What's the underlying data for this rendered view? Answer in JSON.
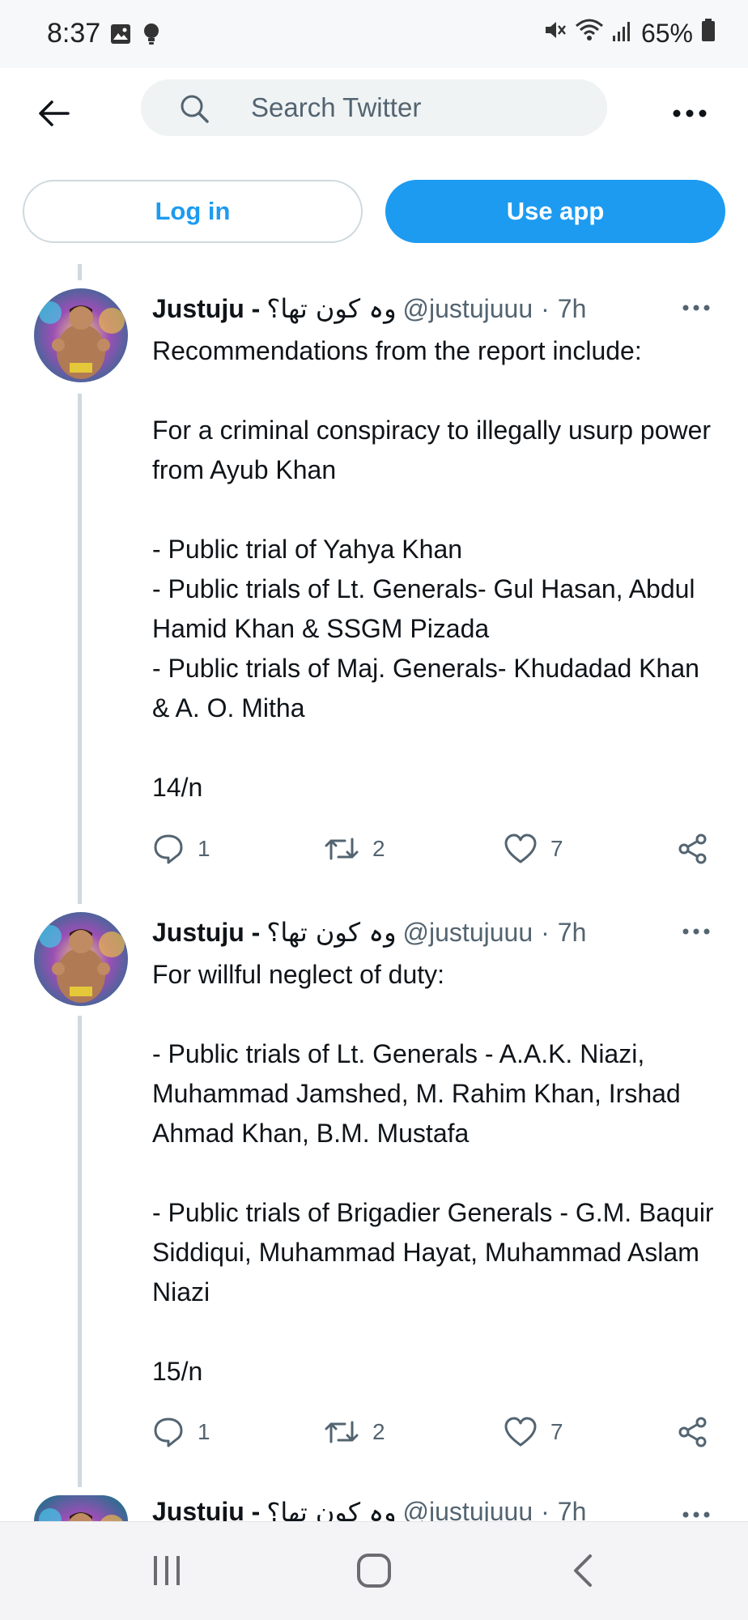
{
  "status_bar": {
    "time": "8:37",
    "battery": "65%",
    "left_icons": [
      "image-icon",
      "bulb-icon"
    ],
    "right_icons": [
      "mute-icon",
      "wifi-icon",
      "signal-icon",
      "battery-icon"
    ]
  },
  "nav": {
    "search_placeholder": "Search Twitter"
  },
  "auth": {
    "login_label": "Log in",
    "useapp_label": "Use app"
  },
  "colors": {
    "accent": "#1d9bf0",
    "text_secondary": "#536471",
    "thread_line": "#cfd9de"
  },
  "tweets": [
    {
      "name": "Justuju -",
      "urdu_name": "وہ کون تھا؟",
      "handle": "@justujuuu",
      "time": "7h",
      "text": "Recommendations from the report include:\n\nFor a criminal conspiracy to illegally usurp power from Ayub Khan\n\n- Public trial of Yahya Khan\n- Public trials of Lt. Generals- Gul Hasan, Abdul Hamid Khan & SSGM Pizada\n- Public trials of Maj. Generals- Khudadad Khan & A. O. Mitha\n\n14/n",
      "replies": "1",
      "retweets": "2",
      "likes": "7"
    },
    {
      "name": "Justuju -",
      "urdu_name": "وہ کون تھا؟",
      "handle": "@justujuuu",
      "time": "7h",
      "text": "For willful neglect of duty:\n\n- Public trials of Lt. Generals - A.A.K. Niazi, Muhammad Jamshed, M. Rahim Khan, Irshad Ahmad Khan, B.M. Mustafa\n\n- Public trials of Brigadier Generals - G.M. Baquir Siddiqui, Muhammad Hayat, Muhammad Aslam Niazi\n\n15/n",
      "replies": "1",
      "retweets": "2",
      "likes": "7"
    },
    {
      "name": "Justuju -",
      "urdu_name": "وہ کون تھا؟",
      "handle": "@justujuuu",
      "time": "7h"
    }
  ],
  "bottom_nav": [
    "recents-icon",
    "home-icon",
    "back-icon"
  ]
}
